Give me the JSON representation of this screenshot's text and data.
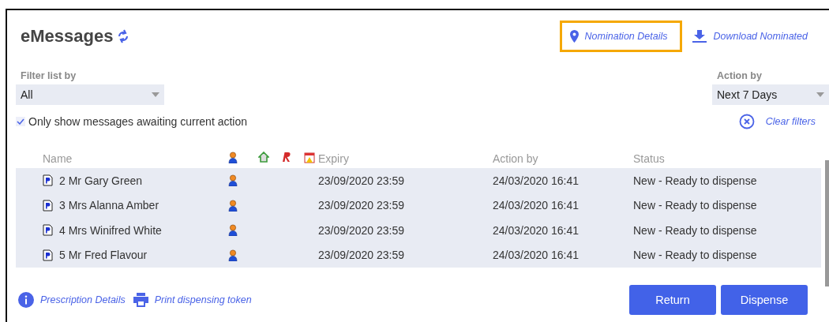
{
  "title": "eMessages",
  "top_links": [
    {
      "kind": "pin",
      "label": "Nomination Details",
      "highlighted": true
    },
    {
      "kind": "download",
      "label": "Download Nominated",
      "highlighted": false
    }
  ],
  "filter": {
    "label": "Filter list by",
    "value": "All"
  },
  "action_by": {
    "label": "Action by",
    "value": "Next 7 Days"
  },
  "only_awaiting": {
    "label": "Only show messages awaiting current action",
    "checked": true
  },
  "clear_filters": "Clear filters",
  "table": {
    "columns": [
      {
        "kind": "text",
        "label": "Name"
      },
      {
        "kind": "person"
      },
      {
        "kind": "house"
      },
      {
        "kind": "r"
      },
      {
        "kind": "calendar"
      },
      {
        "kind": "text",
        "label": "Expiry"
      },
      {
        "kind": "text",
        "label": "Action by"
      },
      {
        "kind": "text",
        "label": "Status"
      }
    ],
    "rows": [
      {
        "name": "2 Mr Gary Green",
        "person": true,
        "expiry": "23/09/2020 23:59",
        "action_by": "24/03/2020 16:41",
        "status": "New - Ready to dispense",
        "selected": true
      },
      {
        "name": "3 Mrs Alanna Amber",
        "person": true,
        "expiry": "23/09/2020 23:59",
        "action_by": "24/03/2020 16:41",
        "status": "New - Ready to dispense",
        "selected": true
      },
      {
        "name": "4 Mrs Winifred White",
        "person": true,
        "expiry": "23/09/2020 23:59",
        "action_by": "24/03/2020 16:41",
        "status": "New - Ready to dispense",
        "selected": true
      },
      {
        "name": "5 Mr Fred Flavour",
        "person": true,
        "expiry": "23/09/2020 23:59",
        "action_by": "24/03/2020 16:41",
        "status": "New - Ready to dispense",
        "selected": true
      }
    ]
  },
  "bottom_links": [
    {
      "kind": "info",
      "label": "Prescription Details"
    },
    {
      "kind": "print",
      "label": "Print dispensing token"
    }
  ],
  "buttons": [
    "Return",
    "Dispense"
  ]
}
